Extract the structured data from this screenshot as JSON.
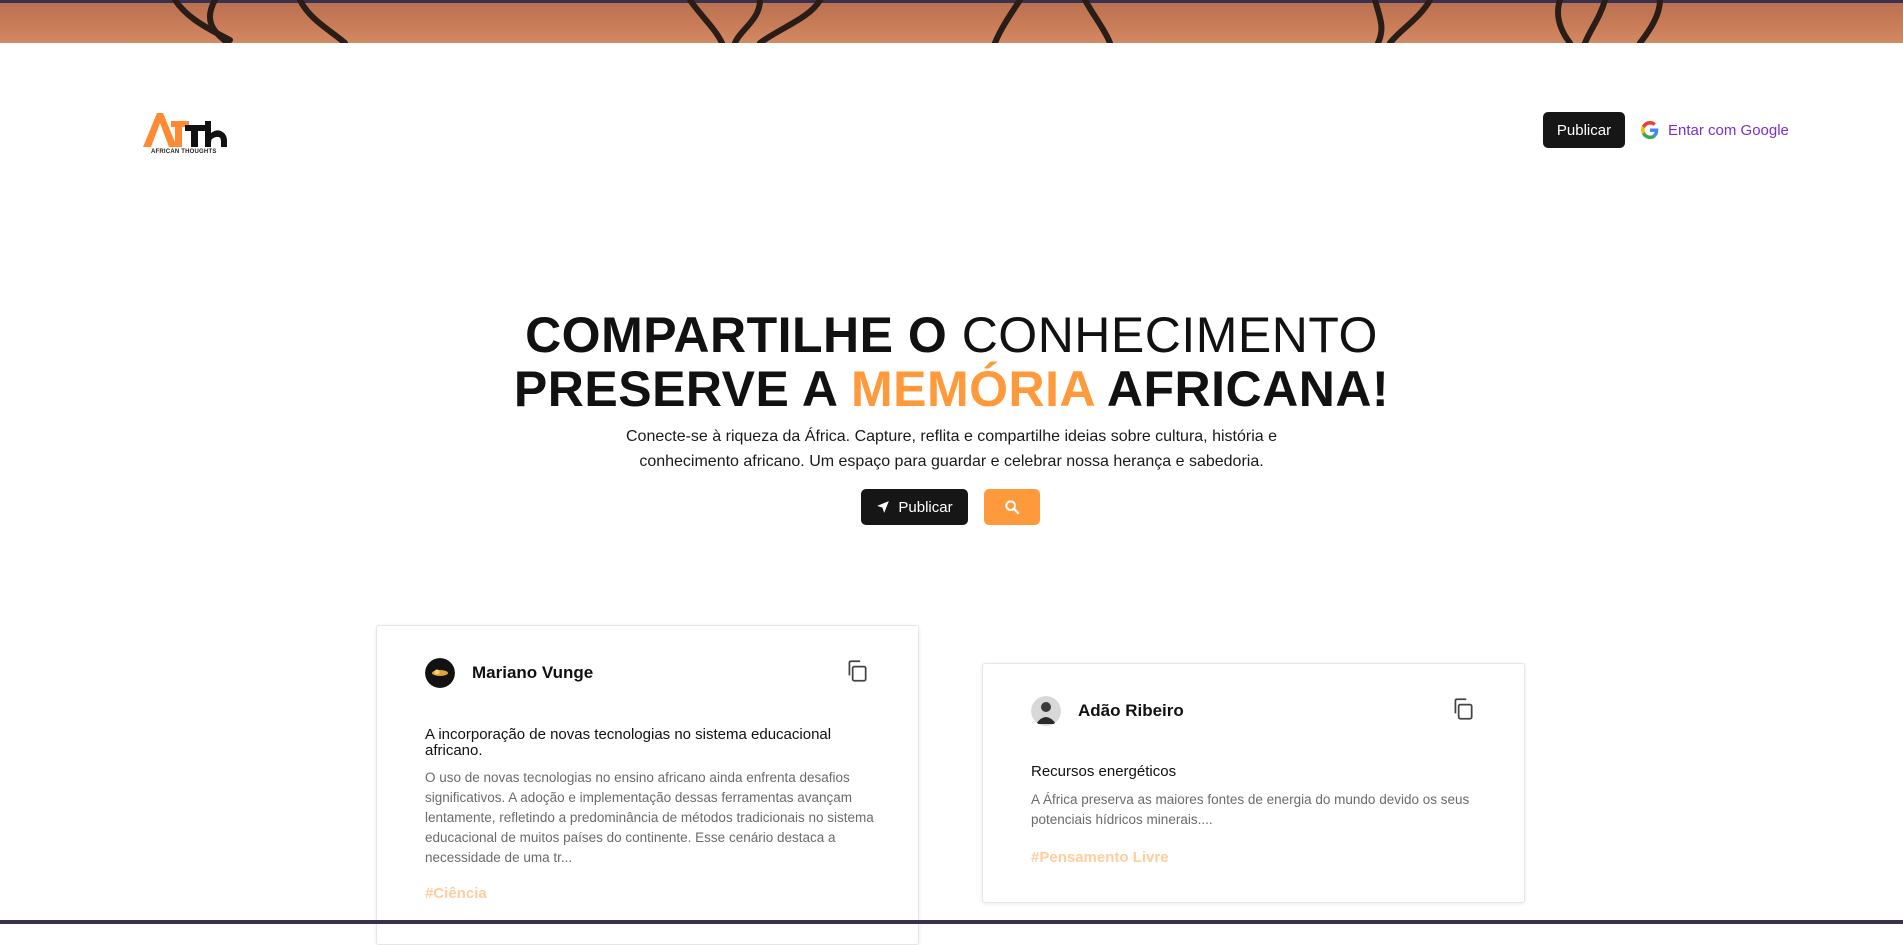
{
  "header": {
    "logo_text": "AFTh",
    "logo_sub": "AFRICAN THOUGHTS",
    "publish_label": "Publicar",
    "google_login_label": "Entar com Google"
  },
  "hero": {
    "title_line1_bold": "COMPARTILHE O",
    "title_line1_thin": "CONHECIMENTO",
    "title_line2_a": "PRESERVE A",
    "title_line2_accent": "MEMÓRIA",
    "title_line2_b": "AFRICANA!",
    "description": "Conecte-se à riqueza da África. Capture, reflita e compartilhe ideias sobre cultura, história e conhecimento africano. Um espaço para guardar e celebrar nossa herança e sabedoria.",
    "publish_label": "Publicar",
    "search_icon": "search-icon"
  },
  "posts": [
    {
      "author": "Mariano Vunge",
      "title": "A incorporação de novas tecnologias no sistema educacional africano.",
      "excerpt": "O uso de novas tecnologias no ensino africano ainda enfrenta desafios significativos. A adoção e implementação dessas ferramentas avançam lentamente, refletindo a predominância de métodos tradicionais no sistema educacional de muitos países do continente. Esse cenário destaca a necessidade de uma tr...",
      "tag": "#Ciência"
    },
    {
      "author": "Adão Ribeiro",
      "title": "Recursos energéticos",
      "excerpt": "A África preserva as maiores fontes de energia do mundo devido os seus potenciais hídricos minerais....",
      "tag": "#Pensamento Livre"
    }
  ],
  "colors": {
    "accent": "#ff9a3c",
    "dark_button": "#161616",
    "google_link": "#7a2fd4",
    "tag": "#ffcd9e"
  }
}
